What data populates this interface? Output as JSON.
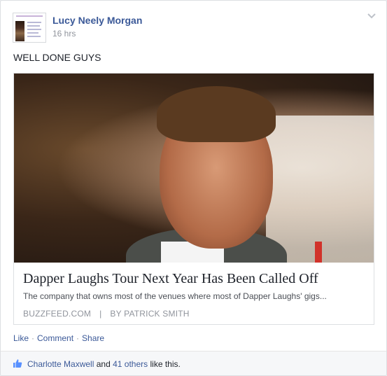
{
  "post": {
    "author": "Lucy Neely Morgan",
    "time": "16 hrs",
    "status_text": "WELL DONE GUYS"
  },
  "link_preview": {
    "title": "Dapper Laughs Tour Next Year Has Been Called Off",
    "description": "The company that owns most of the venues where most of Dapper Laughs' gigs...",
    "source": "BUZZFEED.COM",
    "separator": "|",
    "byline": "BY PATRICK SMITH"
  },
  "actions": {
    "like": "Like",
    "comment": "Comment",
    "share": "Share",
    "dot": "·"
  },
  "likes_bar": {
    "first_liker": "Charlotte Maxwell",
    "and": "and",
    "others": "41 others",
    "suffix": "like this."
  },
  "icons": {
    "chevron": "chevron-down-icon",
    "like": "thumbs-up-icon"
  },
  "colors": {
    "link_blue": "#3b5998",
    "muted_gray": "#90949c"
  }
}
